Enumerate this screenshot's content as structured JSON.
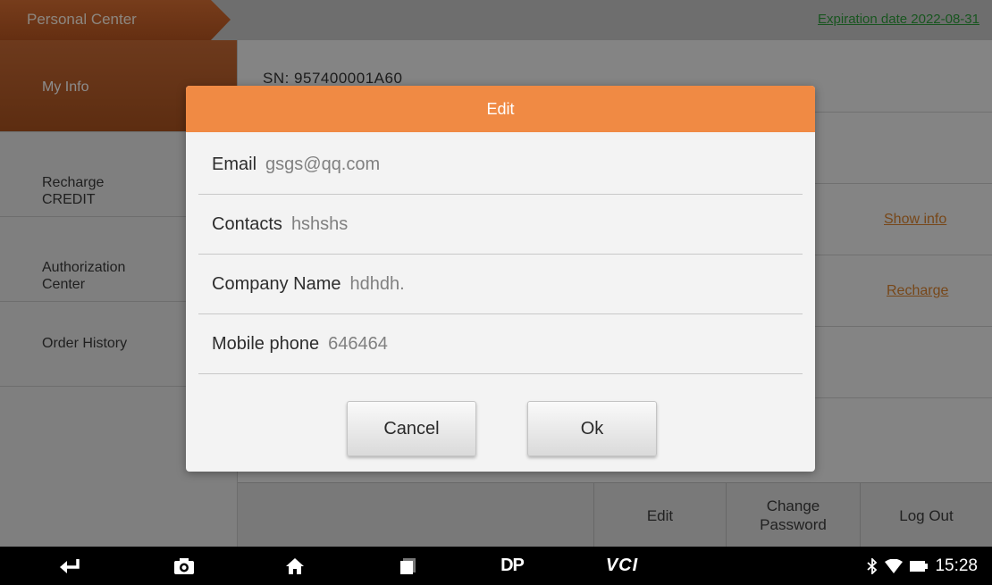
{
  "header": {
    "title": "Personal Center",
    "expiration": "Expiration date 2022-08-31"
  },
  "sidebar": {
    "items": [
      {
        "label": "My Info"
      },
      {
        "label": "Recharge\nCREDIT"
      },
      {
        "label": "Authorization\nCenter"
      },
      {
        "label": "Order History"
      }
    ]
  },
  "main": {
    "sn": "SN: 957400001A60",
    "show_info_link": "Show info",
    "recharge_link": "Recharge"
  },
  "bottom_bar": {
    "edit": "Edit",
    "change_password": "Change\nPassword",
    "log_out": "Log Out"
  },
  "dialog": {
    "title": "Edit",
    "fields": [
      {
        "label": "Email",
        "value": "gsgs@qq.com"
      },
      {
        "label": "Contacts",
        "value": "hshshs"
      },
      {
        "label": "Company Name",
        "value": "hdhdh."
      },
      {
        "label": "Mobile phone",
        "value": "646464"
      }
    ],
    "cancel_label": "Cancel",
    "ok_label": "Ok"
  },
  "navbar": {
    "icons": [
      "back-icon",
      "screenshot-icon",
      "home-icon",
      "recent-apps-icon",
      "dp-icon",
      "vci-icon"
    ],
    "dp_text": "DP",
    "vci_text": "VCI",
    "time": "15:28"
  },
  "colors": {
    "accent_orange": "#f08a44",
    "link_orange": "#d9822e",
    "expiration_green": "#2c9c3a"
  }
}
